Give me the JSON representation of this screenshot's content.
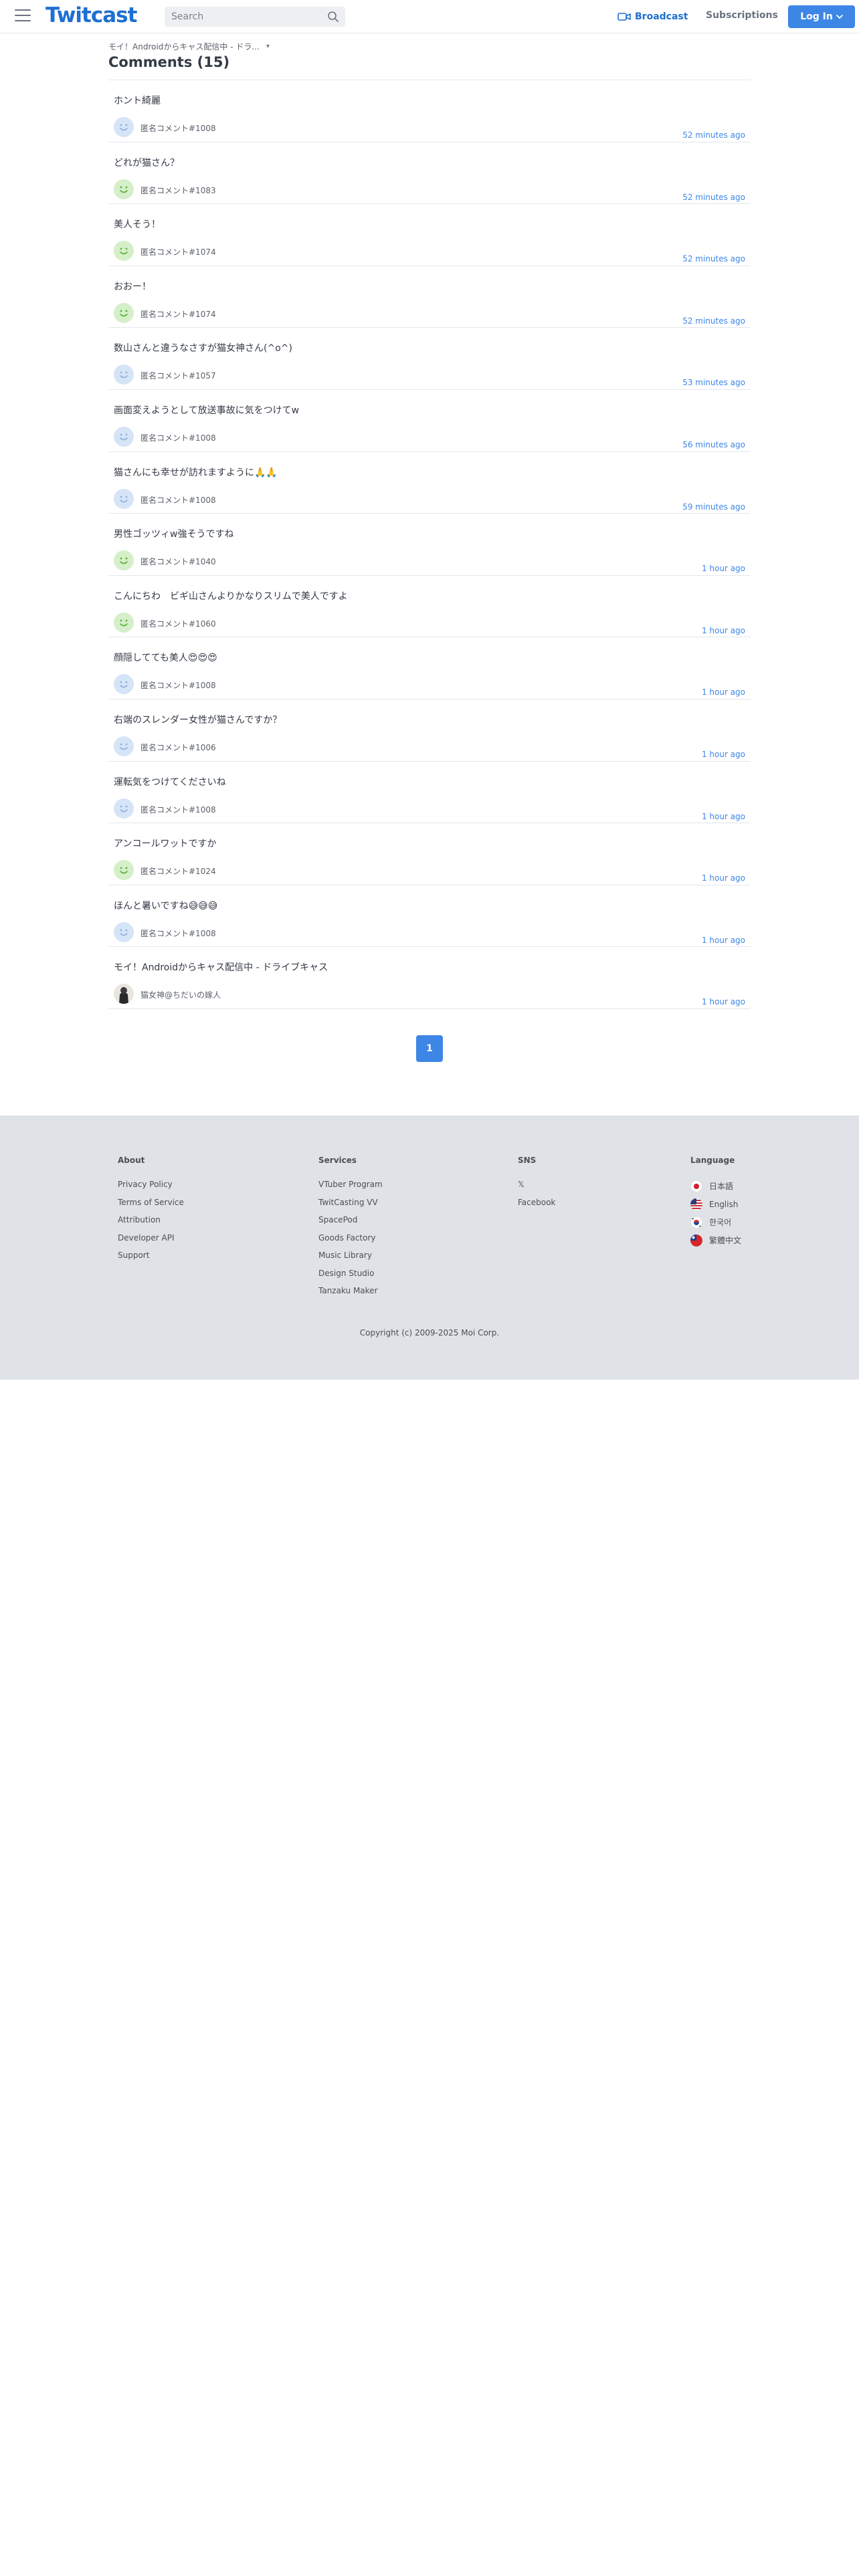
{
  "header": {
    "logo": "Twitcast",
    "search_placeholder": "Search",
    "broadcast": "Broadcast",
    "subscriptions": "Subscriptions",
    "login": "Log In"
  },
  "breadcrumb": "モイ！Androidからキャス配信中 - ドラ...",
  "page_title": "Comments (15)",
  "comments": [
    {
      "text": "ホント綺麗",
      "user": "匿名コメント#1008",
      "time": "52 minutes ago",
      "avatar": "blue"
    },
    {
      "text": "どれが猫さん？",
      "user": "匿名コメント#1083",
      "time": "52 minutes ago",
      "avatar": "green"
    },
    {
      "text": "美人そう！",
      "user": "匿名コメント#1074",
      "time": "52 minutes ago",
      "avatar": "green"
    },
    {
      "text": "おおー！",
      "user": "匿名コメント#1074",
      "time": "52 minutes ago",
      "avatar": "green"
    },
    {
      "text": "数山さんと違うなさすが猫女神さん(^o^)",
      "user": "匿名コメント#1057",
      "time": "53 minutes ago",
      "avatar": "blue"
    },
    {
      "text": "画面変えようとして放送事故に気をつけてw",
      "user": "匿名コメント#1008",
      "time": "56 minutes ago",
      "avatar": "blue"
    },
    {
      "text": "猫さんにも幸せが訪れますように🙏🙏",
      "user": "匿名コメント#1008",
      "time": "59 minutes ago",
      "avatar": "blue"
    },
    {
      "text": "男性ゴッツィw強そうですね",
      "user": "匿名コメント#1040",
      "time": "1 hour ago",
      "avatar": "green"
    },
    {
      "text": "こんにちわ　ビギ山さんよりかなりスリムで美人ですよ",
      "user": "匿名コメント#1060",
      "time": "1 hour ago",
      "avatar": "green"
    },
    {
      "text": "顔隠してても美人😍😍😍",
      "user": "匿名コメント#1008",
      "time": "1 hour ago",
      "avatar": "blue"
    },
    {
      "text": "右端のスレンダー女性が猫さんですか？",
      "user": "匿名コメント#1006",
      "time": "1 hour ago",
      "avatar": "blue"
    },
    {
      "text": "運転気をつけてくださいね",
      "user": "匿名コメント#1008",
      "time": "1 hour ago",
      "avatar": "blue"
    },
    {
      "text": "アンコールワットですか",
      "user": "匿名コメント#1024",
      "time": "1 hour ago",
      "avatar": "green"
    },
    {
      "text": "ほんと暑いですね😅😅😅",
      "user": "匿名コメント#1008",
      "time": "1 hour ago",
      "avatar": "blue"
    },
    {
      "text": "モイ！Androidからキャス配信中 - ドライブキャス",
      "user": "猫女神@ちだいの嫁人",
      "time": "1 hour ago",
      "avatar": "photo"
    }
  ],
  "pagination": {
    "current": "1"
  },
  "footer": {
    "about": {
      "title": "About",
      "links": [
        "Privacy Policy",
        "Terms of Service",
        "Attribution",
        "Developer API",
        "Support"
      ]
    },
    "services": {
      "title": "Services",
      "links": [
        "VTuber Program",
        "TwitCasting VV",
        "SpacePod",
        "Goods Factory",
        "Music Library",
        "Design Studio",
        "Tanzaku Maker"
      ]
    },
    "sns": {
      "title": "SNS",
      "links": [
        "𝕏",
        "Facebook"
      ]
    },
    "language": {
      "title": "Language",
      "items": [
        "日本語",
        "English",
        "한국어",
        "繁體中文"
      ]
    },
    "copyright": "Copyright (c) 2009-2025 Moi Corp."
  },
  "colors": {
    "accent": "#3d86e6",
    "logo": "#1f6fd1",
    "footer_bg": "#dfe2e6"
  }
}
